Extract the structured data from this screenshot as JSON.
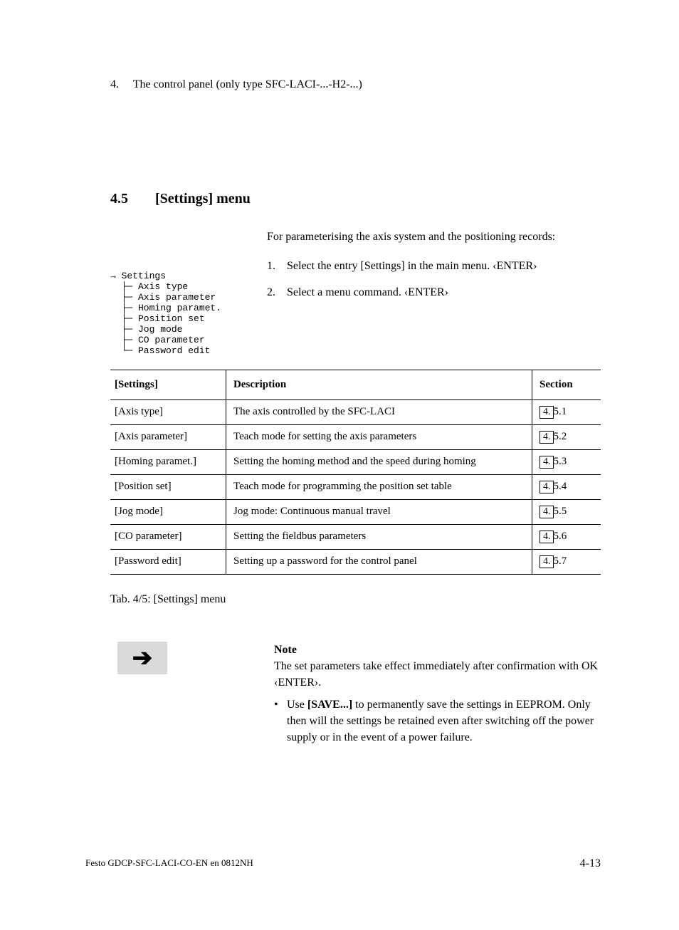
{
  "chapter": {
    "number": "4.",
    "title": "The control panel (only type SFC-LACI-...-H2-...)"
  },
  "section": {
    "number": "4.5",
    "title": "[Settings] menu"
  },
  "menu_tree": "→ Settings\n  ├─ Axis type\n  ├─ Axis parameter\n  ├─ Homing paramet.\n  ├─ Position set\n  ├─ Jog mode\n  ├─ CO parameter\n  └─ Password edit",
  "intro": {
    "para": "For parameterising the axis system and the positioning records:",
    "steps": [
      {
        "n": "1.",
        "t": "Select the entry [Settings] in the main menu. ‹ENTER›"
      },
      {
        "n": "2.",
        "t": "Select a menu command. ‹ENTER›"
      }
    ]
  },
  "table": {
    "headers": {
      "settings": "[Settings]",
      "description": "Description",
      "section": "Section"
    },
    "rows": [
      {
        "name": "[Axis type]",
        "desc": "The axis controlled by the SFC-LACI",
        "link_a": "4.",
        "link_b": "5.1"
      },
      {
        "name": "[Axis parameter]",
        "desc": "Teach mode for setting the axis parameters",
        "link_a": "4.",
        "link_b": "5.2"
      },
      {
        "name": "[Homing paramet.]",
        "desc": "Setting the homing method and the speed during homing",
        "link_a": "4.",
        "link_b": "5.3"
      },
      {
        "name": "[Position set]",
        "desc": "Teach mode for programming the position set table",
        "link_a": "4.",
        "link_b": "5.4"
      },
      {
        "name": "[Jog mode]",
        "desc": "Jog mode: Continuous manual travel",
        "link_a": "4.",
        "link_b": "5.5"
      },
      {
        "name": "[CO parameter]",
        "desc": "Setting the fieldbus parameters",
        "link_a": "4.",
        "link_b": "5.6"
      },
      {
        "name": "[Password edit]",
        "desc": "Setting up a password for the control panel",
        "link_a": "4.",
        "link_b": "5.7"
      }
    ],
    "caption": "Tab. 4/5:  [Settings] menu"
  },
  "note": {
    "title": "Note",
    "para": "The set parameters take effect immediately after confirma­tion with OK ‹ENTER›.",
    "bullet_prefix": "Use ",
    "bullet_bold": "[SAVE...] ",
    "bullet_rest": "to permanently save the settings in EEPROM. Only then will the settings be retained even after switching off the power supply or in the event of a power failure."
  },
  "footer": {
    "left": "Festo GDCP-SFC-LACI-CO-EN en 0812NH",
    "right": "4-13"
  }
}
